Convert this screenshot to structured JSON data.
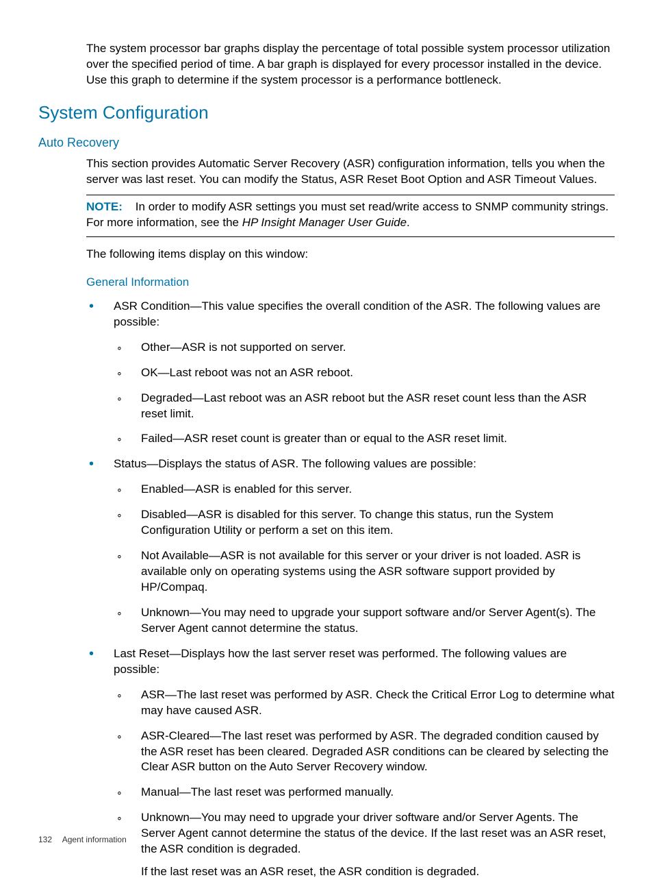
{
  "intro": "The system processor bar graphs display the percentage of total possible system processor utilization over the specified period of time. A bar graph is displayed for every processor installed in the device. Use this graph to determine if the system processor is a performance bottleneck.",
  "h1": "System Configuration",
  "h2": "Auto Recovery",
  "sectionPara": "This section provides Automatic Server Recovery (ASR) configuration information, tells you when the server was last reset. You can modify the Status, ASR Reset Boot Option and ASR Timeout Values.",
  "noteLabel": "NOTE:",
  "notePrefix": "In order to modify ASR settings you must set read/write access to SNMP community strings. For more information, see the ",
  "noteItalic": "HP Insight Manager User Guide",
  "noteSuffix": ".",
  "followup": "The following items display on this window:",
  "h3": "General Information",
  "items": [
    {
      "text": "ASR Condition—This value specifies the overall condition of the ASR. The following values are possible:",
      "sub": [
        "Other—ASR is not supported on server.",
        "OK—Last reboot was not an ASR reboot.",
        "Degraded—Last reboot was an ASR reboot but the ASR reset count less than the ASR reset limit.",
        "Failed—ASR reset count is greater than or equal to the ASR reset limit."
      ]
    },
    {
      "text": "Status—Displays the status of ASR. The following values are possible:",
      "sub": [
        "Enabled—ASR is enabled for this server.",
        "Disabled—ASR is disabled for this server. To change this status, run the System Configuration Utility or perform a set on this item.",
        "Not Available—ASR is not available for this server or your driver is not loaded. ASR is available only on operating systems using the ASR software support provided by HP/Compaq.",
        "Unknown—You may need to upgrade your support software and/or Server Agent(s). The Server Agent cannot determine the status."
      ]
    },
    {
      "text": "Last Reset—Displays how the last server reset was performed. The following values are possible:",
      "sub": [
        "ASR—The last reset was performed by ASR. Check the Critical Error Log to determine what may have caused ASR.",
        "ASR-Cleared—The last reset was performed by ASR. The degraded condition caused by the ASR reset has been cleared. Degraded ASR conditions can be cleared by selecting the Clear ASR button on the Auto Server Recovery window.",
        "Manual—The last reset was performed manually.",
        "Unknown—You may need to upgrade your driver software and/or Server Agents. The Server Agent cannot determine the status of the device. If the last reset was an ASR reset, the ASR condition is degraded."
      ],
      "trail": "If the last reset was an ASR reset, the ASR condition is degraded."
    }
  ],
  "footer": {
    "page": "132",
    "title": "Agent information"
  }
}
